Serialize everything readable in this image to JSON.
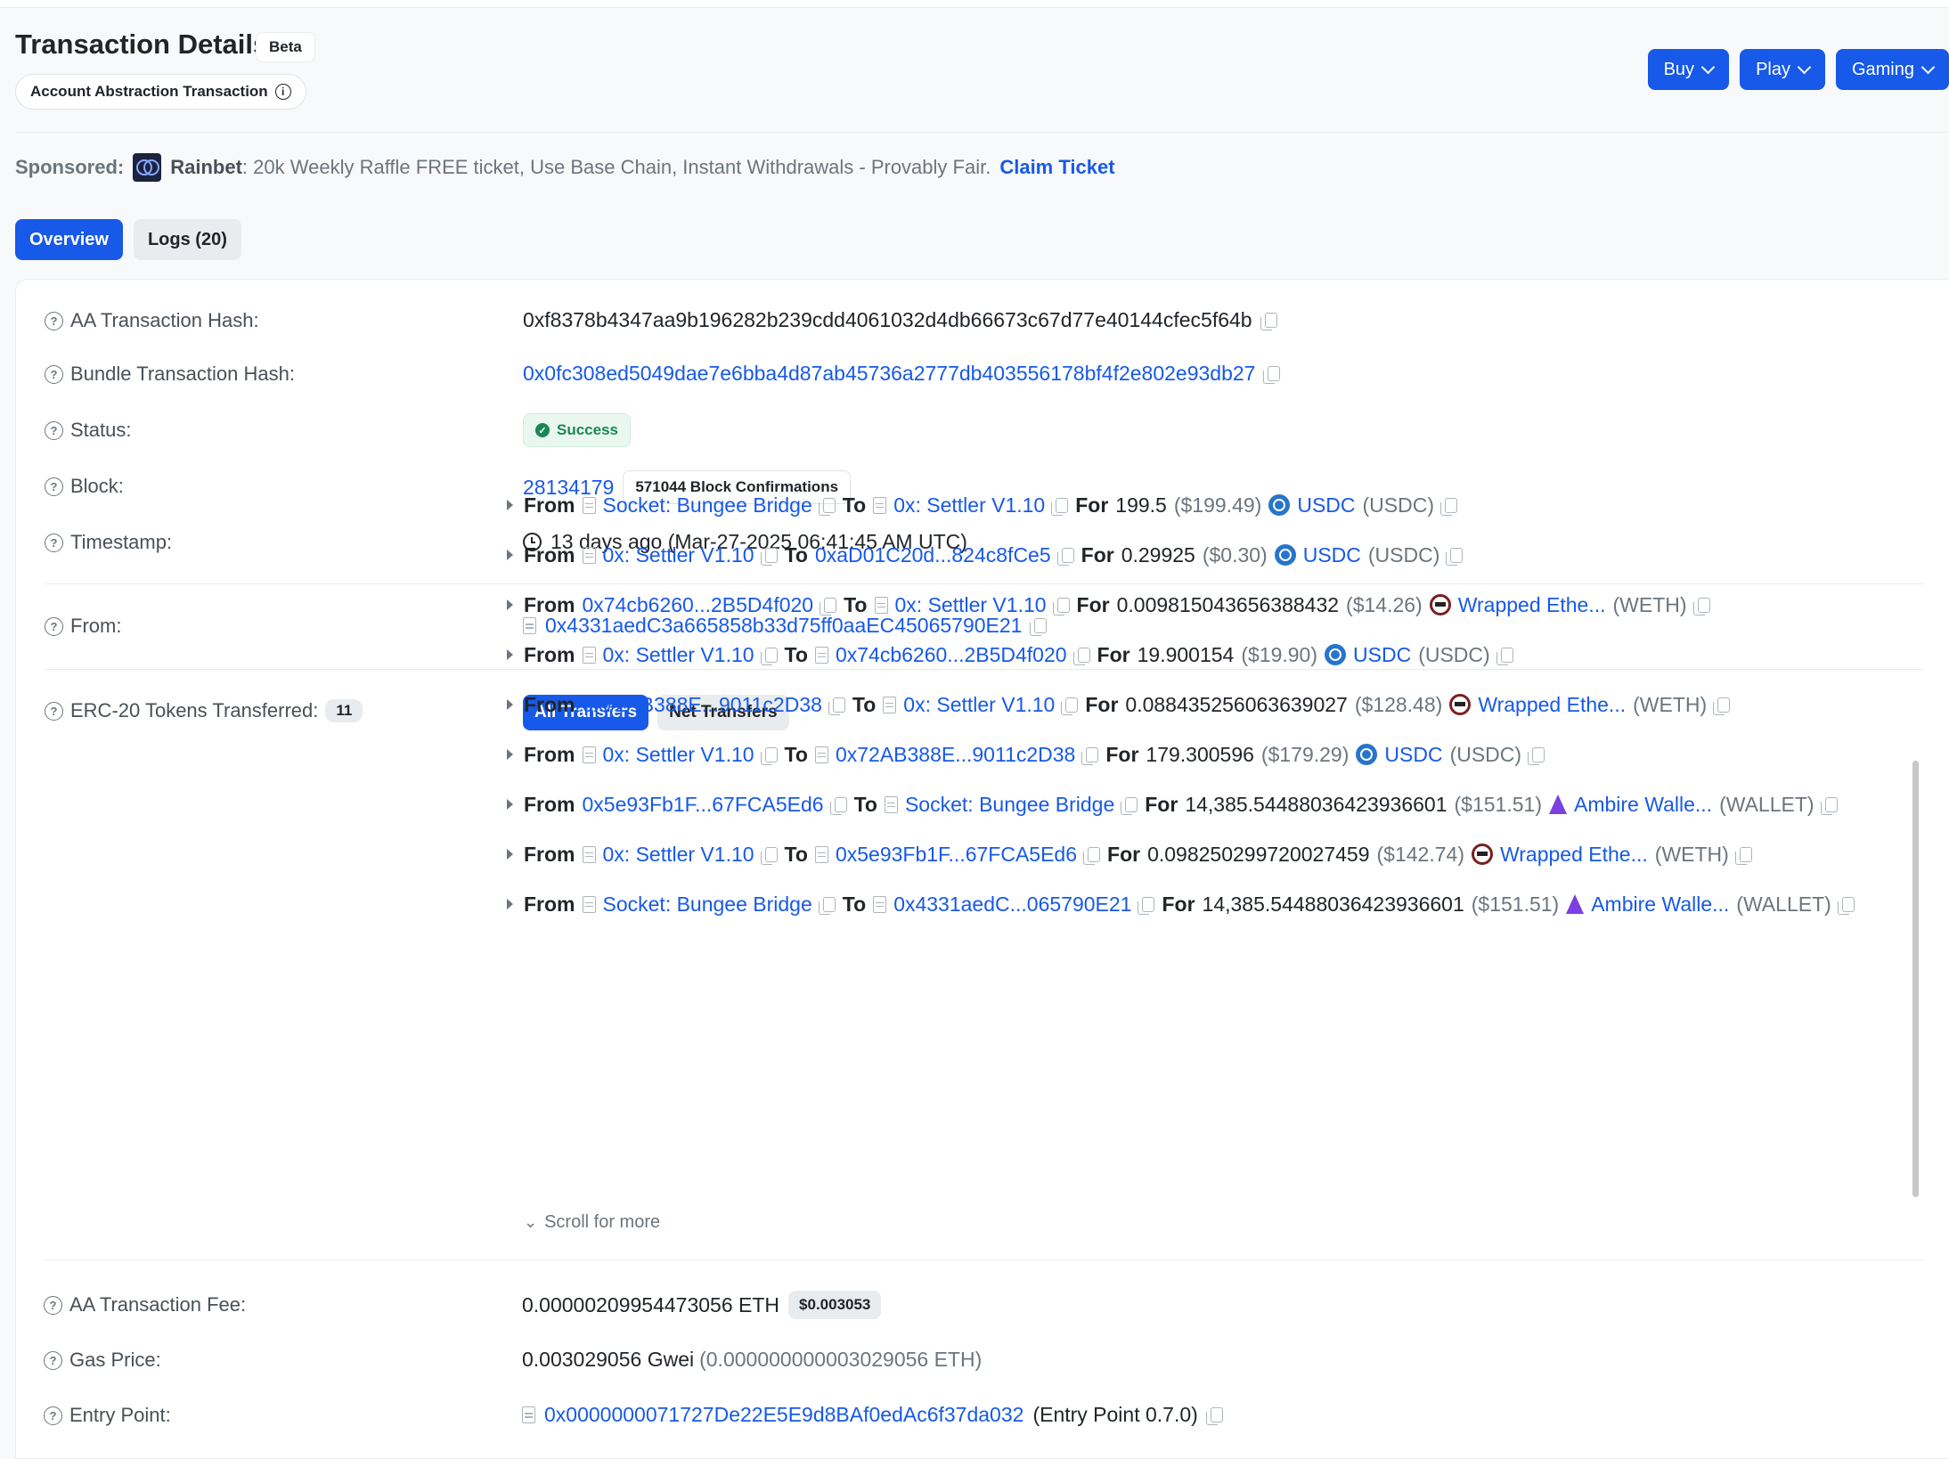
{
  "header": {
    "title": "Transaction Details",
    "beta": "Beta",
    "aa_badge": "Account Abstraction Transaction",
    "buttons": [
      "Buy",
      "Play",
      "Gaming"
    ]
  },
  "sponsored": {
    "label": "Sponsored:",
    "brand": "Rainbet",
    "text": ": 20k Weekly Raffle FREE ticket, Use Base Chain, Instant Withdrawals - Provably Fair.",
    "link": "Claim Ticket"
  },
  "tabs": [
    "Overview",
    "Logs (20)"
  ],
  "details": {
    "aa_hash": {
      "label": "AA Transaction Hash:",
      "value": "0xf8378b4347aa9b196282b239cdd4061032d4db66673c67d77e40144cfec5f64b"
    },
    "bundle_hash": {
      "label": "Bundle Transaction Hash:",
      "value": "0x0fc308ed5049dae7e6bba4d87ab45736a2777db403556178bf4f2e802e93db27"
    },
    "status": {
      "label": "Status:",
      "value": "Success"
    },
    "block": {
      "label": "Block:",
      "value": "28134179",
      "confirmations": "571044 Block Confirmations"
    },
    "timestamp": {
      "label": "Timestamp:",
      "value": "13 days ago (Mar-27-2025 06:41:45 AM UTC)"
    },
    "from": {
      "label": "From:",
      "value": "0x4331aedC3a665858b33d75ff0aaEC45065790E21"
    },
    "erc20": {
      "label": "ERC-20 Tokens Transferred:",
      "count": "11",
      "filters": [
        "All Transfers",
        "Net Transfers"
      ]
    },
    "fee": {
      "label": "AA Transaction Fee:",
      "value": "0.00000209954473056 ETH",
      "usd": "$0.003053"
    },
    "gas": {
      "label": "Gas Price:",
      "value": "0.003029056 Gwei",
      "eth": "(0.000000000003029056 ETH)"
    },
    "entry": {
      "label": "Entry Point:",
      "value": "0x0000000071727De22E5E9d8BAf0edAc6f37da032",
      "suffix": "(Entry Point 0.7.0)"
    }
  },
  "transfers": [
    {
      "from": "Socket: Bungee Bridge",
      "from_doc": true,
      "to": "0x: Settler V1.10",
      "to_doc": true,
      "amount": "199.5",
      "usd": "($199.49)",
      "token_icon": "usdc-icon",
      "token": "USDC",
      "symbol": "(USDC)"
    },
    {
      "from": "0x: Settler V1.10",
      "from_doc": true,
      "to": "0xaD01C20d...824c8fCe5",
      "to_doc": false,
      "amount": "0.29925",
      "usd": "($0.30)",
      "token_icon": "usdc-icon",
      "token": "USDC",
      "symbol": "(USDC)"
    },
    {
      "from": "0x74cb6260...2B5D4f020",
      "from_doc": false,
      "to": "0x: Settler V1.10",
      "to_doc": true,
      "amount": "0.009815043656388432",
      "usd": "($14.26)",
      "token_icon": "weth-icon",
      "token": "Wrapped Ethe...",
      "symbol": "(WETH)"
    },
    {
      "from": "0x: Settler V1.10",
      "from_doc": true,
      "to": "0x74cb6260...2B5D4f020",
      "to_doc": true,
      "amount": "19.900154",
      "usd": "($19.90)",
      "token_icon": "usdc-icon",
      "token": "USDC",
      "symbol": "(USDC)"
    },
    {
      "from": "0x72AB388E...9011c2D38",
      "from_doc": false,
      "to": "0x: Settler V1.10",
      "to_doc": true,
      "amount": "0.088435256063639027",
      "usd": "($128.48)",
      "token_icon": "weth-icon",
      "token": "Wrapped Ethe...",
      "symbol": "(WETH)"
    },
    {
      "from": "0x: Settler V1.10",
      "from_doc": true,
      "to": "0x72AB388E...9011c2D38",
      "to_doc": true,
      "amount": "179.300596",
      "usd": "($179.29)",
      "token_icon": "usdc-icon",
      "token": "USDC",
      "symbol": "(USDC)"
    },
    {
      "from": "0x5e93Fb1F...67FCA5Ed6",
      "from_doc": false,
      "to": "Socket: Bungee Bridge",
      "to_doc": true,
      "amount": "14,385.54488036423936601",
      "usd": "($151.51)",
      "token_icon": "wallet-icon",
      "token": "Ambire Walle...",
      "symbol": "(WALLET)"
    },
    {
      "from": "0x: Settler V1.10",
      "from_doc": true,
      "to": "0x5e93Fb1F...67FCA5Ed6",
      "to_doc": true,
      "amount": "0.098250299720027459",
      "usd": "($142.74)",
      "token_icon": "weth-icon",
      "token": "Wrapped Ethe...",
      "symbol": "(WETH)"
    },
    {
      "from": "Socket: Bungee Bridge",
      "from_doc": true,
      "to": "0x4331aedC...065790E21",
      "to_doc": true,
      "amount": "14,385.54488036423936601",
      "usd": "($151.51)",
      "token_icon": "wallet-icon",
      "token": "Ambire Walle...",
      "symbol": "(WALLET)"
    }
  ],
  "labels": {
    "from": "From",
    "to": "To",
    "for": "For",
    "scroll_more": "Scroll for more"
  },
  "colors": {
    "accent": "#1759e8",
    "success": "#198754"
  }
}
